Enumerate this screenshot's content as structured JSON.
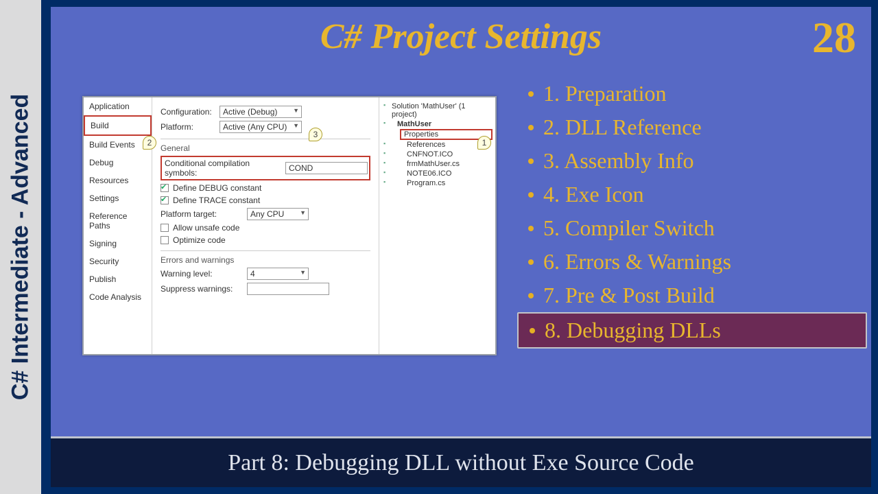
{
  "slide": {
    "title": "C# Project Settings",
    "number": "28",
    "footer": "Part 8: Debugging DLL without Exe Source Code",
    "side_label": "C# Intermediate - Advanced"
  },
  "agenda": [
    "1. Preparation",
    "2. DLL Reference",
    "3. Assembly Info",
    "4. Exe Icon",
    "5. Compiler Switch",
    "6. Errors & Warnings",
    "7. Pre & Post Build",
    "8. Debugging DLLs"
  ],
  "agenda_highlight_index": 7,
  "vs": {
    "tabs": [
      "Application",
      "Build",
      "Build Events",
      "Debug",
      "Resources",
      "Settings",
      "Reference Paths",
      "Signing",
      "Security",
      "Publish",
      "Code Analysis"
    ],
    "selected_tab": "Build",
    "config_label": "Configuration:",
    "config_value": "Active (Debug)",
    "platform_label": "Platform:",
    "platform_value": "Active (Any CPU)",
    "general_group": "General",
    "cond_label": "Conditional compilation symbols:",
    "cond_value": "COND",
    "chk_debug": "Define DEBUG constant",
    "chk_trace": "Define TRACE constant",
    "ptarget_label": "Platform target:",
    "ptarget_value": "Any CPU",
    "chk_unsafe": "Allow unsafe code",
    "chk_opt": "Optimize code",
    "errwarn_group": "Errors and warnings",
    "warn_label": "Warning level:",
    "warn_value": "4",
    "suppress_label": "Suppress warnings:",
    "sol": {
      "root": "Solution 'MathUser' (1 project)",
      "proj": "MathUser",
      "props": "Properties",
      "refs": "References",
      "f1": "CNFNOT.ICO",
      "f2": "frmMathUser.cs",
      "f3": "NOTE06.ICO",
      "f4": "Program.cs"
    },
    "callouts": {
      "c1": "1",
      "c2": "2",
      "c3": "3"
    }
  }
}
